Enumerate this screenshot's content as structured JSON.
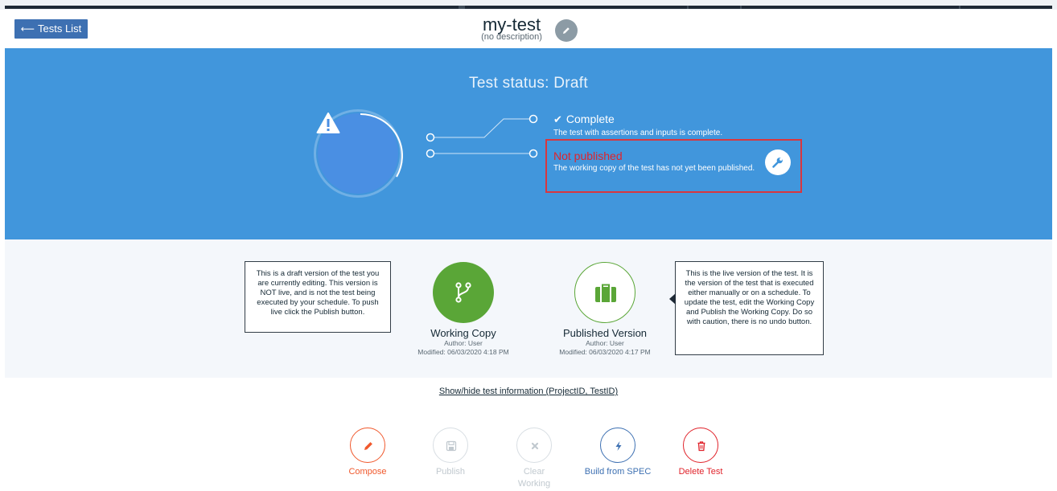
{
  "header": {
    "back_label": "Tests List",
    "title": "my-test",
    "description": "(no description)"
  },
  "status": {
    "title": "Test status: Draft",
    "complete": {
      "label": "Complete",
      "description": "The test with assertions and inputs is complete."
    },
    "publish": {
      "label": "Not published",
      "description": "The working copy of the test has not yet been published."
    }
  },
  "versions": {
    "draft_note": "This is a draft version of the test you are currently editing. This version is NOT live, and is not the test being executed by your schedule. To push live click the Publish button.",
    "live_note": "This is the live version of the test. It is the version of the test that is executed either manually or on a schedule. To update the test, edit the Working Copy and Publish the Working Copy. Do so with caution, there is no undo button.",
    "working": {
      "title": "Working Copy",
      "author": "Author: User",
      "modified": "Modified: 06/03/2020 4:18 PM"
    },
    "published": {
      "title": "Published Version",
      "author": "Author: User",
      "modified": "Modified: 06/03/2020 4:17 PM"
    }
  },
  "info_toggle": "Show/hide test information (ProjectID, TestID)",
  "actions": {
    "compose": "Compose",
    "publish": "Publish",
    "clear": "Clear Working Copy",
    "build": "Build from SPEC",
    "delete": "Delete Test"
  },
  "colors": {
    "status_band": "#4196dc",
    "primary": "#3d70b2",
    "success": "#5aa637",
    "danger": "#e0232b",
    "compose": "#f0582c"
  },
  "icons": {
    "back": "arrow-left-icon",
    "edit_title": "pencil-icon",
    "status": "warning-icon",
    "complete": "checkmark-icon",
    "fix": "wrench-icon",
    "working_copy": "branch-icon",
    "published": "briefcase-icon",
    "compose": "pencil-icon",
    "publish": "save-icon",
    "clear": "close-icon",
    "build": "lightning-icon",
    "delete": "trash-icon"
  }
}
